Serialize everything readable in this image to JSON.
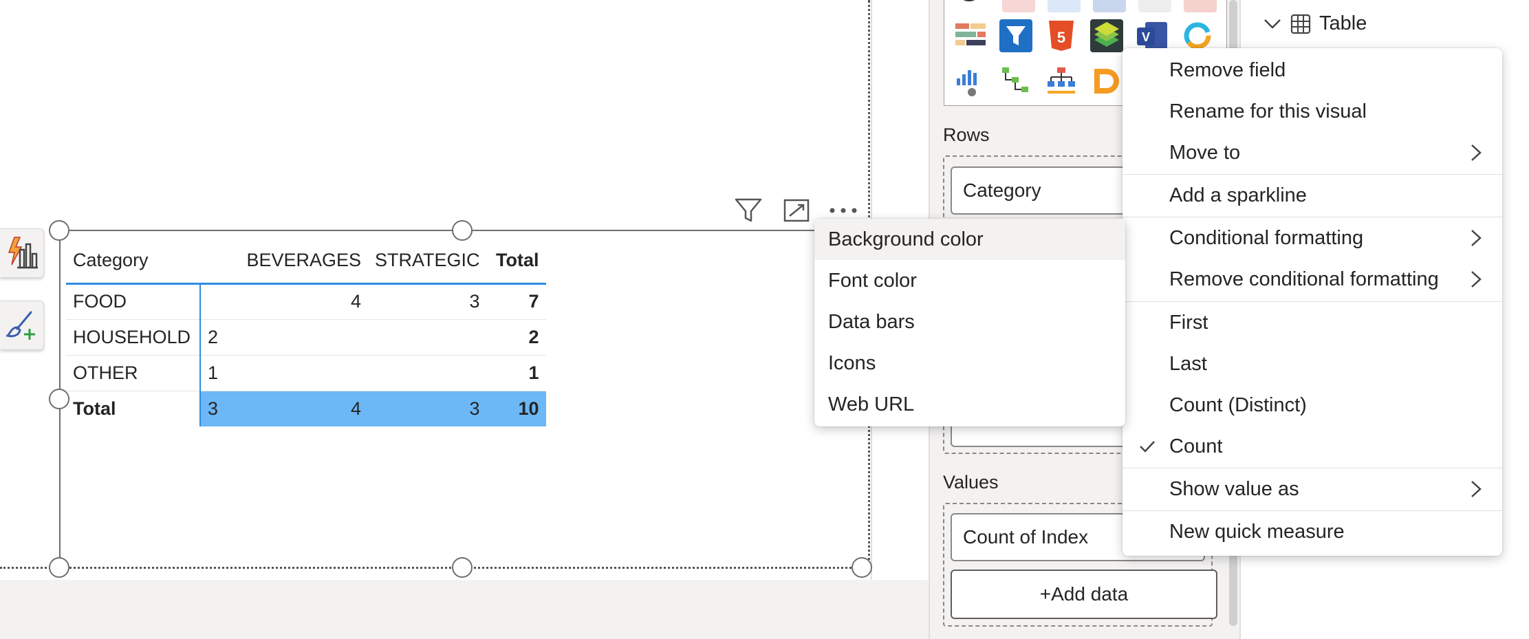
{
  "matrix": {
    "headers": [
      "Category",
      "",
      "BEVERAGES",
      "STRATEGIC",
      "Total"
    ],
    "rows": [
      {
        "category": "FOOD",
        "blank": "",
        "beverages": "4",
        "strategic": "3",
        "total": "7"
      },
      {
        "category": "HOUSEHOLD",
        "blank": "2",
        "beverages": "",
        "strategic": "",
        "total": "2"
      },
      {
        "category": "OTHER",
        "blank": "1",
        "beverages": "",
        "strategic": "",
        "total": "1"
      }
    ],
    "total_row": {
      "label": "Total",
      "blank": "3",
      "beverages": "4",
      "strategic": "3",
      "total": "10"
    }
  },
  "build_panel": {
    "rows_label": "Rows",
    "rows_field": "Category",
    "values_label": "Values",
    "values_field": "Count of Index",
    "add_data_label": "+Add data"
  },
  "fields_panel": {
    "table_label": "Table"
  },
  "context_menu": {
    "items": [
      "Remove field",
      "Rename for this visual",
      "Move to",
      "Add a sparkline",
      "Conditional formatting",
      "Remove conditional formatting",
      "First",
      "Last",
      "Count (Distinct)",
      "Count",
      "Show value as",
      "New quick measure"
    ],
    "checked_item": "Count"
  },
  "submenu": {
    "items": [
      "Background color",
      "Font color",
      "Data bars",
      "Icons",
      "Web URL"
    ],
    "highlighted": "Background color"
  },
  "colors": {
    "accent_blue": "#2d8ce3",
    "selection_fill": "#6cb8f6"
  }
}
